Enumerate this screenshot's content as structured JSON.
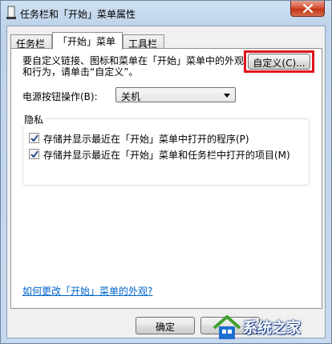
{
  "window": {
    "title": "任务栏和「开始」菜单属性"
  },
  "tabs": [
    {
      "label": "任务栏"
    },
    {
      "label": "「开始」菜单",
      "active": true
    },
    {
      "label": "工具栏"
    }
  ],
  "start_menu": {
    "description": "要自定义链接、图标和菜单在「开始」菜单中的外观和行为，请单击“自定义”。",
    "customize_button": "自定义(C)...",
    "power_label": "电源按钮操作(B):",
    "power_value": "关机",
    "privacy": {
      "title": "隐私",
      "items": [
        {
          "label": "存储并显示最近在「开始」菜单中打开的程序(P)",
          "checked": true
        },
        {
          "label": "存储并显示最近在「开始」菜单和任务栏中打开的项目(M)",
          "checked": true
        }
      ]
    },
    "help_link": "如何更改「开始」菜单的外观?"
  },
  "footer": {
    "ok_button": "确定"
  },
  "watermark": {
    "text": "系统之家",
    "icon": "house-logo-icon"
  },
  "colors": {
    "highlight": "#e0151d",
    "link": "#0066cc"
  }
}
